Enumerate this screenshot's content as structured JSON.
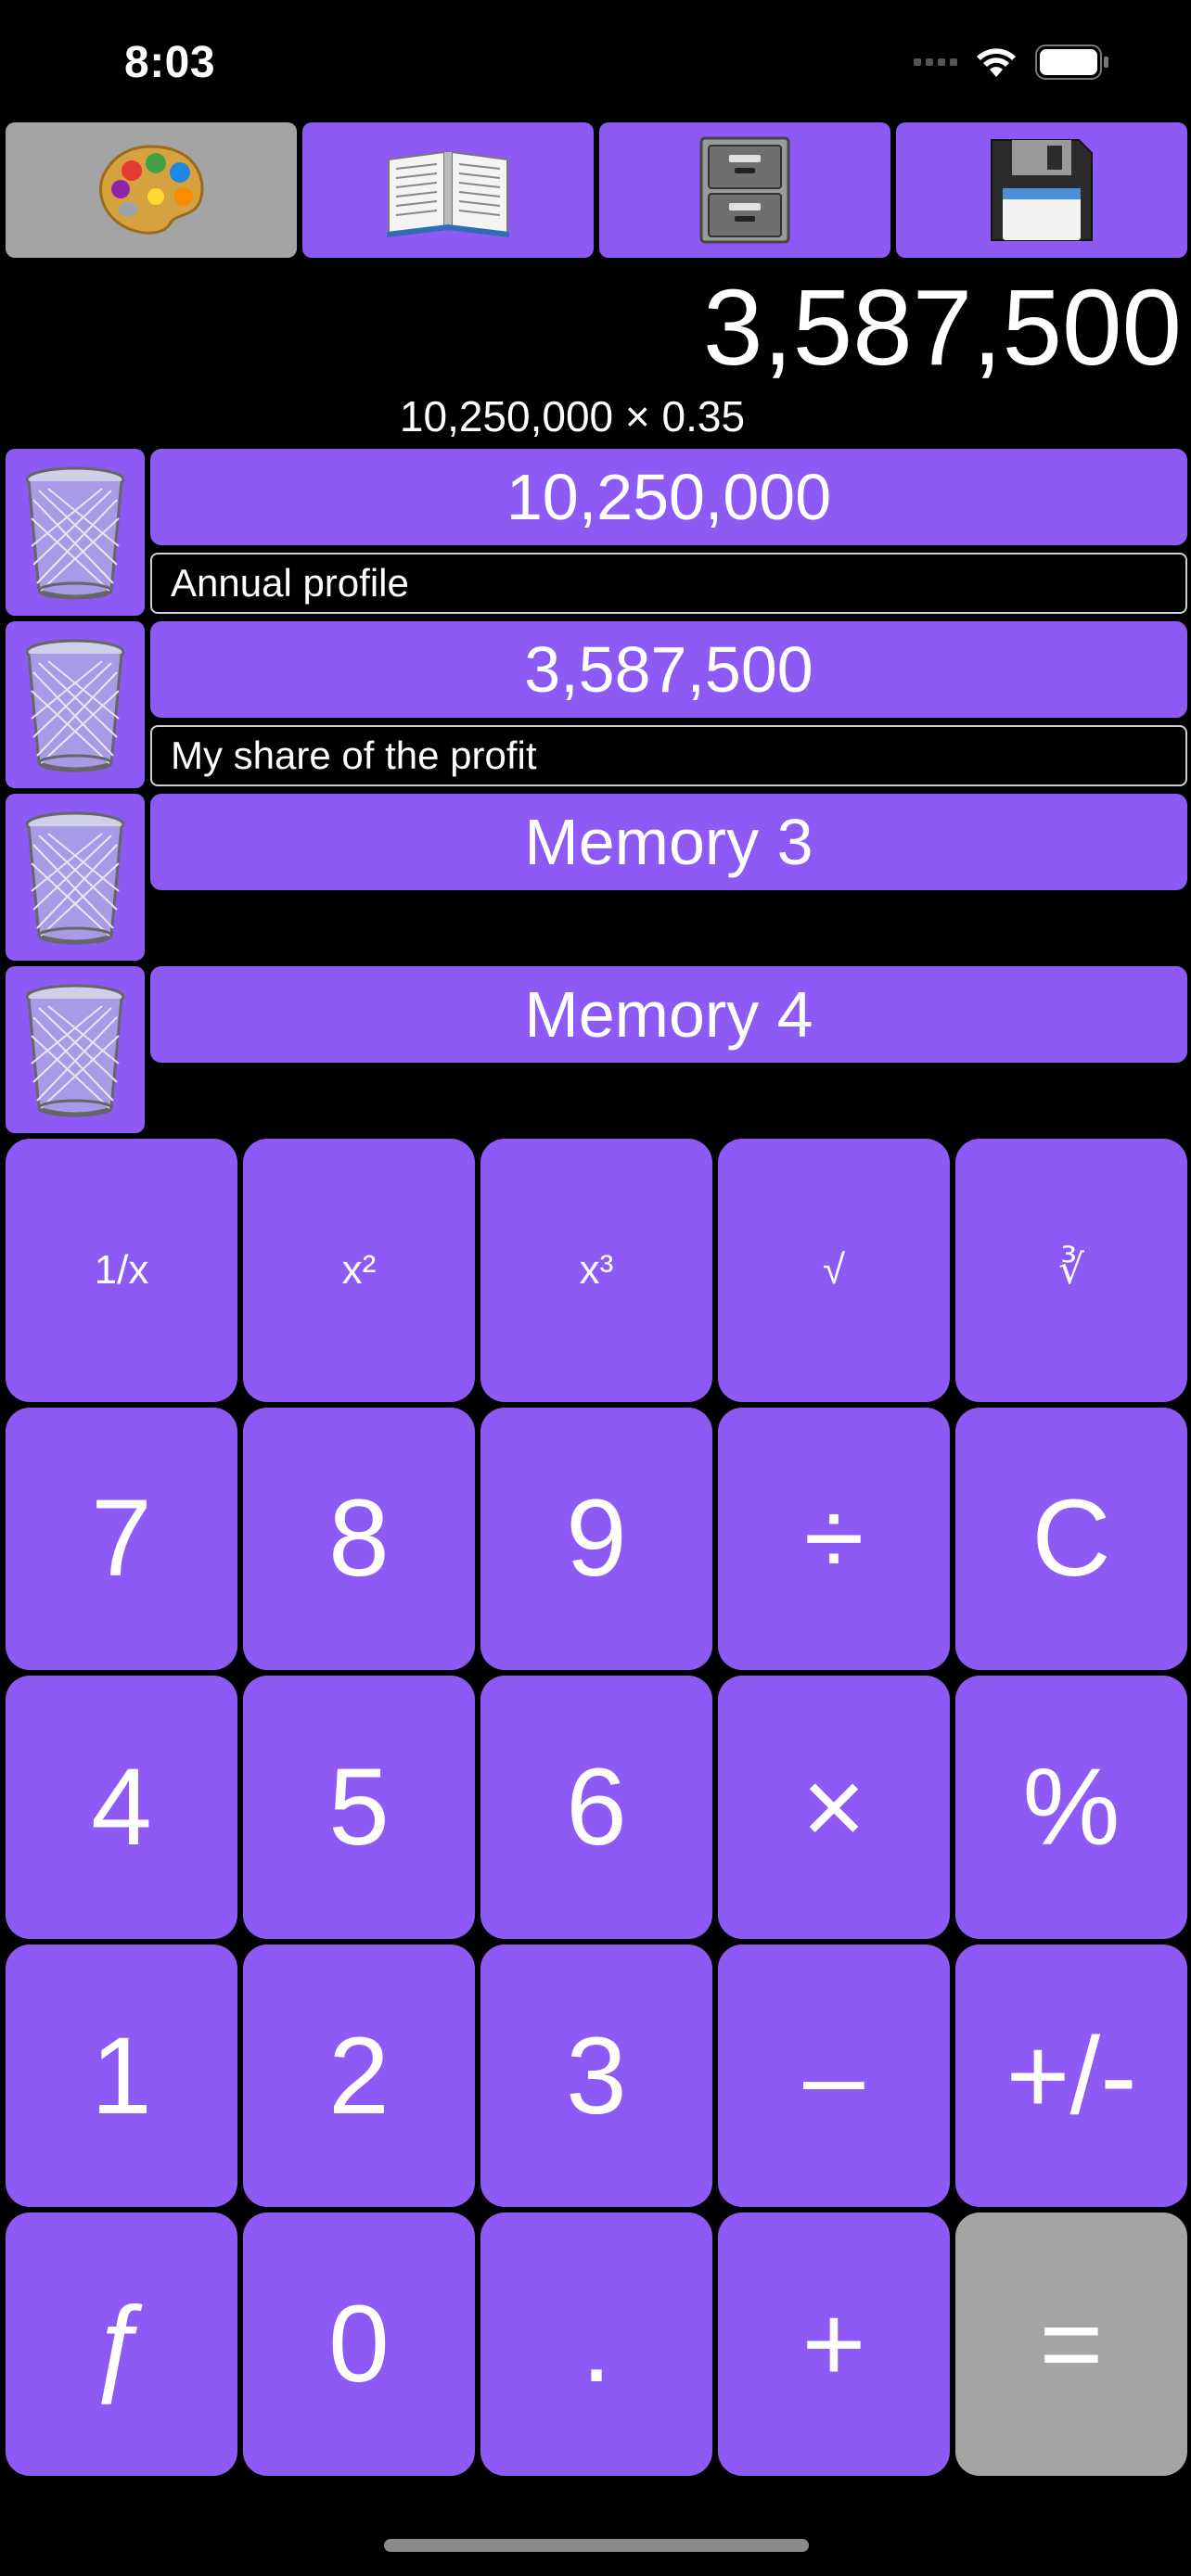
{
  "status": {
    "time": "8:03"
  },
  "toolbar": [
    {
      "name": "palette-icon",
      "bg": "grey"
    },
    {
      "name": "book-icon",
      "bg": "purple"
    },
    {
      "name": "file-cabinet-icon",
      "bg": "purple"
    },
    {
      "name": "floppy-disk-icon",
      "bg": "purple"
    }
  ],
  "display": {
    "main": "3,587,500",
    "expression": "10,250,000 × 0.35"
  },
  "memories": [
    {
      "value": "10,250,000",
      "label": "Annual profile"
    },
    {
      "value": "3,587,500",
      "label": "My share of the profit"
    },
    {
      "value": "Memory 3",
      "label": ""
    },
    {
      "value": "Memory 4",
      "label": ""
    }
  ],
  "keys": [
    {
      "label": "1/x",
      "name": "reciprocal-key",
      "small": true
    },
    {
      "label": "x²",
      "name": "square-key",
      "small": true
    },
    {
      "label": "x³",
      "name": "cube-key",
      "small": true
    },
    {
      "label": "√",
      "name": "square-root-key",
      "small": true
    },
    {
      "label": "∛",
      "name": "cube-root-key",
      "small": true
    },
    {
      "label": "7",
      "name": "digit-7-key"
    },
    {
      "label": "8",
      "name": "digit-8-key"
    },
    {
      "label": "9",
      "name": "digit-9-key"
    },
    {
      "label": "÷",
      "name": "divide-key"
    },
    {
      "label": "C",
      "name": "clear-key"
    },
    {
      "label": "4",
      "name": "digit-4-key"
    },
    {
      "label": "5",
      "name": "digit-5-key"
    },
    {
      "label": "6",
      "name": "digit-6-key"
    },
    {
      "label": "×",
      "name": "multiply-key"
    },
    {
      "label": "%",
      "name": "percent-key"
    },
    {
      "label": "1",
      "name": "digit-1-key"
    },
    {
      "label": "2",
      "name": "digit-2-key"
    },
    {
      "label": "3",
      "name": "digit-3-key"
    },
    {
      "label": "–",
      "name": "subtract-key"
    },
    {
      "label": "+/-",
      "name": "sign-toggle-key"
    },
    {
      "label": "ƒ",
      "name": "function-key"
    },
    {
      "label": "0",
      "name": "digit-0-key"
    },
    {
      "label": ".",
      "name": "decimal-key"
    },
    {
      "label": "+",
      "name": "add-key"
    },
    {
      "label": "=",
      "name": "equals-key",
      "grey": true
    }
  ],
  "colors": {
    "accent": "#8e5af5",
    "grey": "#a4a4a4",
    "background": "#000000"
  }
}
